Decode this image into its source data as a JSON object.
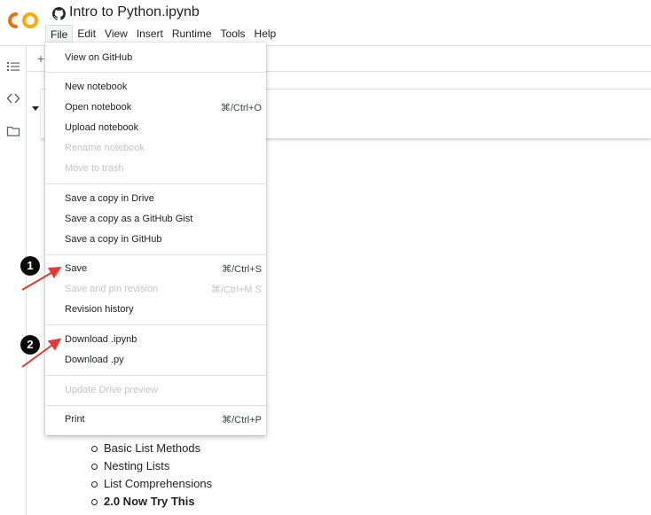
{
  "app": {
    "notebook_title": "Intro to Python.ipynb",
    "brand_colors": {
      "orange": "#F9AB00",
      "dark_orange": "#E8710A"
    }
  },
  "menubar": {
    "items": [
      "File",
      "Edit",
      "View",
      "Insert",
      "Runtime",
      "Tools",
      "Help"
    ],
    "active": "File"
  },
  "toolbar": {
    "add_label": "+"
  },
  "file_menu": {
    "view_on_github": "View on GitHub",
    "new_notebook": "New notebook",
    "open_notebook": "Open notebook",
    "open_notebook_shortcut": "⌘/Ctrl+O",
    "upload_notebook": "Upload notebook",
    "rename_notebook": "Rename notebook",
    "move_to_trash": "Move to trash",
    "save_copy_drive": "Save a copy in Drive",
    "save_copy_gist": "Save a copy as a GitHub Gist",
    "save_copy_github": "Save a copy in GitHub",
    "save": "Save",
    "save_shortcut": "⌘/Ctrl+S",
    "save_pin": "Save and pin revision",
    "save_pin_shortcut": "⌘/Ctrl+M S",
    "revision_history": "Revision history",
    "download_ipynb": "Download .ipynb",
    "download_py": "Download .py",
    "update_drive_preview": "Update Drive preview",
    "print": "Print",
    "print_shortcut": "⌘/Ctrl+P"
  },
  "annotations": {
    "callout_1": "1",
    "callout_2": "2",
    "arrow_color": "#e53935"
  },
  "toc": {
    "items": [
      "Basic List Methods",
      "Nesting Lists",
      "List Comprehensions",
      "2.0 Now Try This"
    ]
  }
}
